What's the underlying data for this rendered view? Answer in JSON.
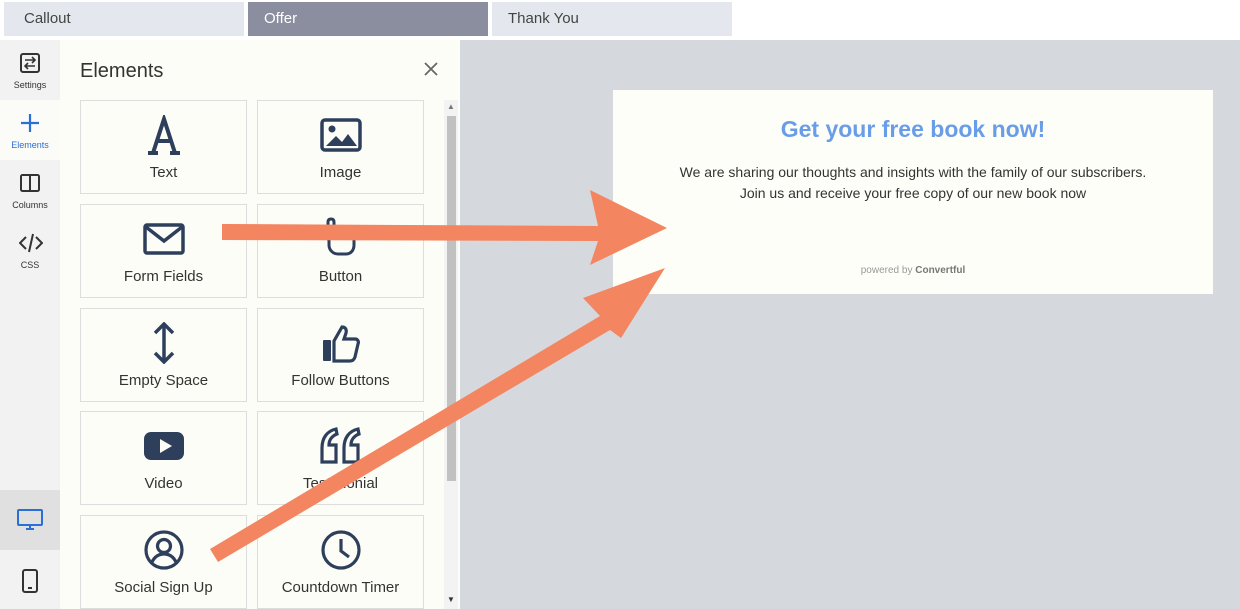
{
  "tabs": {
    "callout": "Callout",
    "offer": "Offer",
    "thank_you": "Thank You"
  },
  "rail": {
    "settings": "Settings",
    "elements": "Elements",
    "columns": "Columns",
    "css": "CSS"
  },
  "panel": {
    "title": "Elements",
    "tiles": {
      "text": "Text",
      "image": "Image",
      "form_fields": "Form Fields",
      "button": "Button",
      "empty_space": "Empty Space",
      "follow_buttons": "Follow Buttons",
      "video": "Video",
      "testimonial": "Testimonial",
      "social_sign_up": "Social Sign Up",
      "countdown_timer": "Countdown Timer"
    }
  },
  "popup": {
    "heading": "Get your free book now!",
    "line1": "We are sharing our thoughts and insights with the family of our subscribers.",
    "line2": "Join us and receive your free copy of our new book now",
    "powered_prefix": "powered by",
    "powered_brand": "Convertful"
  },
  "colors": {
    "accent_blue": "#6a9de8",
    "active_tab": "#8b8e9f",
    "arrow": "#f38560",
    "icon_navy": "#2e3f5c"
  }
}
